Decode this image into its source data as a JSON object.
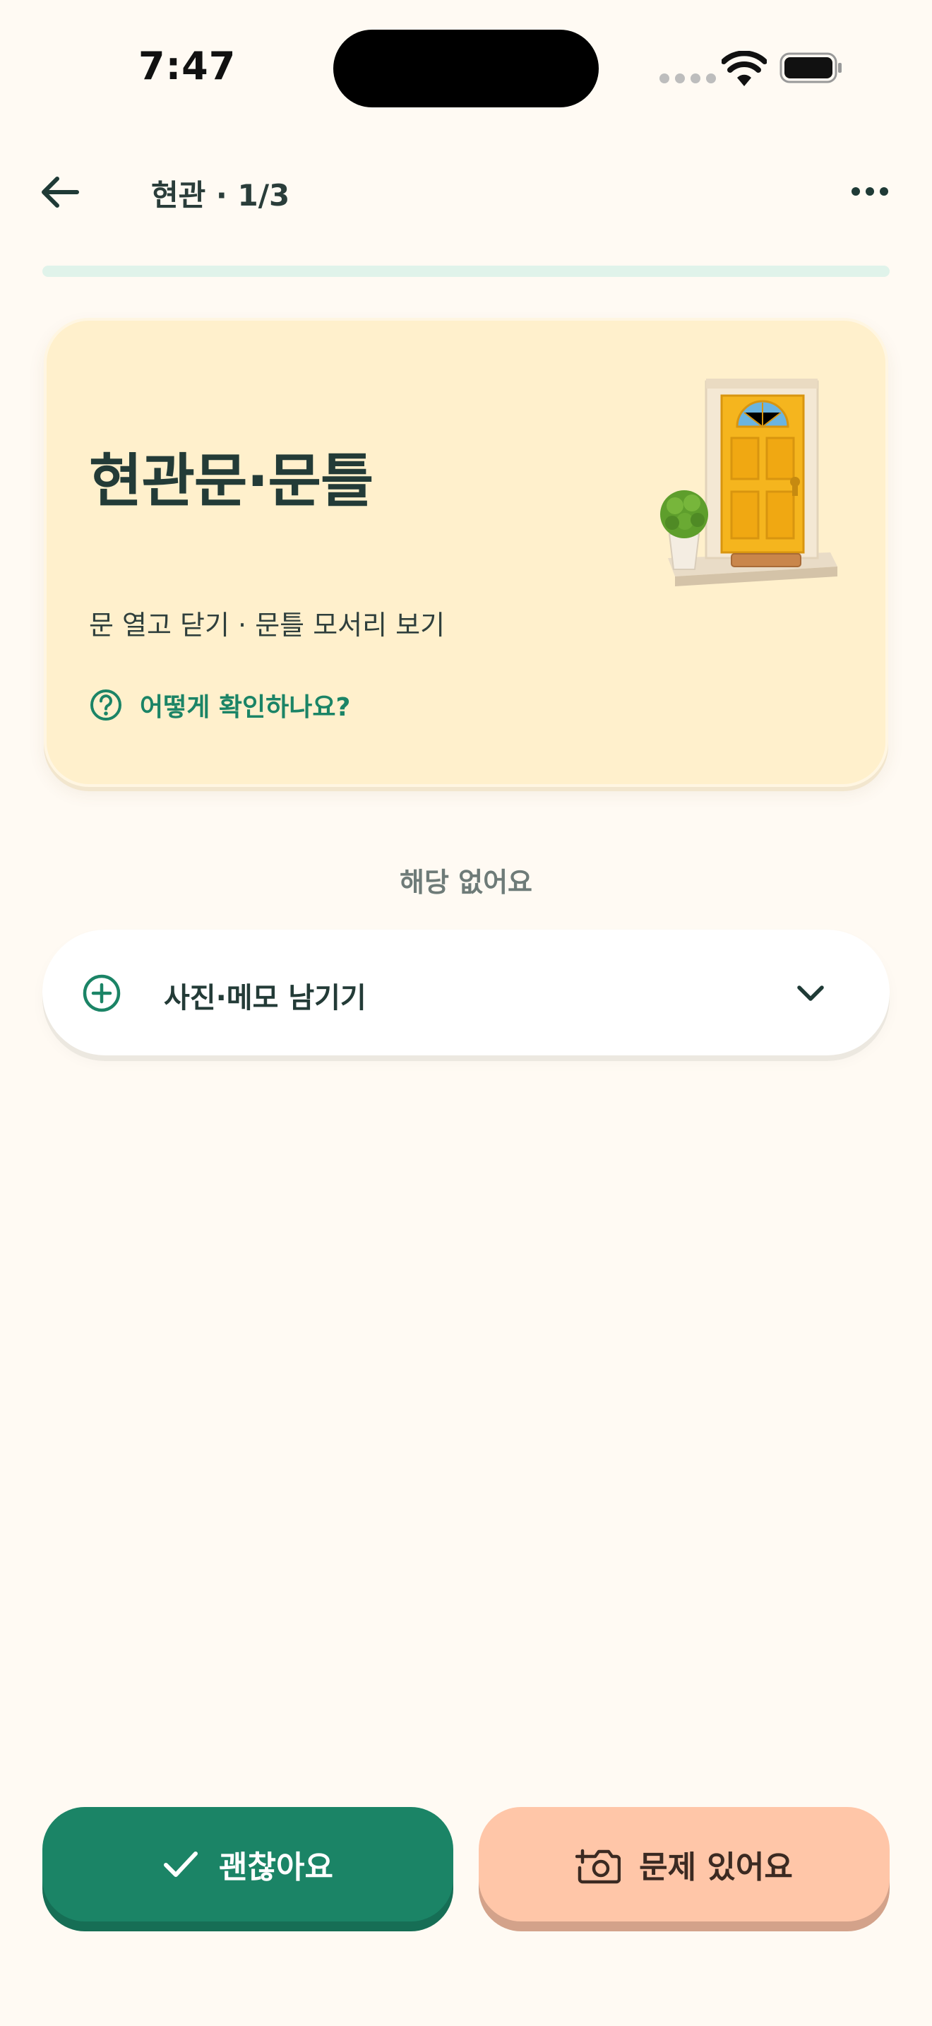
{
  "status_bar": {
    "time": "7:47"
  },
  "header": {
    "title": "현관 · 1/3",
    "back_icon": "arrow-left-icon",
    "more_icon": "more-horizontal-icon"
  },
  "progress": {
    "value": 0.0
  },
  "item": {
    "title": "현관문·문틀",
    "description": "문 열고 닫기 · 문틀 모서리 보기",
    "help_label": "어떻게 확인하나요?",
    "illustration": "front-door-illustration"
  },
  "na_label": "해당 없어요",
  "notes": {
    "label": "사진·메모 남기기"
  },
  "actions": {
    "ok_label": "괜찮아요",
    "issue_label": "문제 있어요"
  },
  "colors": {
    "accent": "#1B8466",
    "background": "#FFFAF3",
    "card": "#FFF0CC",
    "issue": "#FFC6A8"
  }
}
